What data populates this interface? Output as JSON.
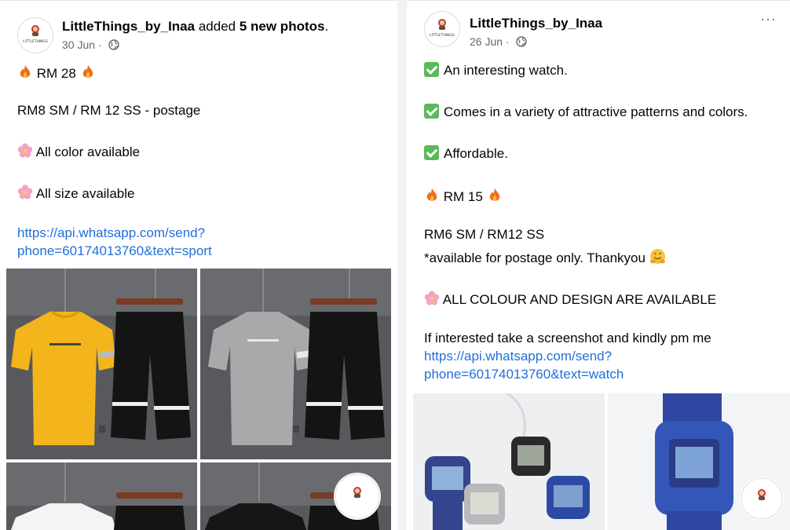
{
  "left_post": {
    "author": "LittleThings_by_Inaa",
    "action_prefix": "added",
    "action_bold": "5 new photos",
    "action_suffix": ".",
    "date": "30 Jun",
    "separator": "·",
    "avatar_text": "LITTLETHINGS",
    "lines": {
      "price": "RM 28",
      "postage": "RM8 SM / RM 12 SS - postage",
      "color": "All color available",
      "size": "All size available",
      "link1": "https://api.whatsapp.com/send?",
      "link2": "phone=60174013760&text=sport"
    }
  },
  "right_post": {
    "author": "LittleThings_by_Inaa",
    "date": "26 Jun",
    "separator": "·",
    "more": "···",
    "lines": {
      "f1": "An interesting watch.",
      "f2": "Comes in a variety of attractive patterns and colors.",
      "f3": "Affordable.",
      "price": "RM 15",
      "postage1": "RM6 SM / RM12 SS",
      "postage2": "*available for postage only. Thankyou",
      "design": "ALL COLOUR AND DESIGN ARE AVAILABLE",
      "cta": "If interested take a screenshot and kindly pm me",
      "link1": "https://api.whatsapp.com/send?",
      "link2": "phone=60174013760&text=watch"
    }
  },
  "colors": {
    "link": "#216fdb",
    "muted": "#65676b",
    "check": "#5cb85c"
  }
}
